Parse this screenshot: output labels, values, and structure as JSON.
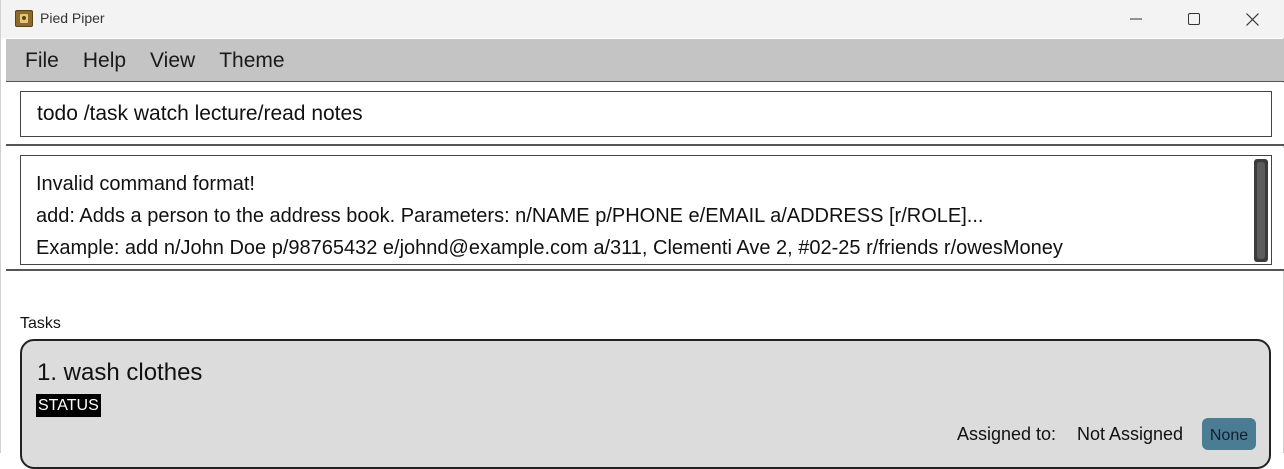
{
  "window": {
    "title": "Pied Piper"
  },
  "menu": {
    "items": [
      "File",
      "Help",
      "View",
      "Theme"
    ]
  },
  "command_box": {
    "value": "todo /task watch lecture/read notes"
  },
  "result": {
    "lines": [
      "Invalid command format!",
      "add: Adds a person to the address book. Parameters: n/NAME p/PHONE e/EMAIL a/ADDRESS [r/ROLE]...",
      "Example: add n/John Doe p/98765432 e/johnd@example.com a/311, Clementi Ave 2, #02-25 r/friends r/owesMoney"
    ]
  },
  "tasks": {
    "label": "Tasks",
    "items": [
      {
        "title": "1. wash clothes",
        "status": "STATUS",
        "assigned_label": "Assigned to:",
        "assigned_value": "Not Assigned",
        "tag": "None"
      }
    ]
  },
  "colors": {
    "menu_bg": "#c4c4c4",
    "card_bg": "#dcdcdc",
    "tag_bg": "#4a7d93"
  }
}
